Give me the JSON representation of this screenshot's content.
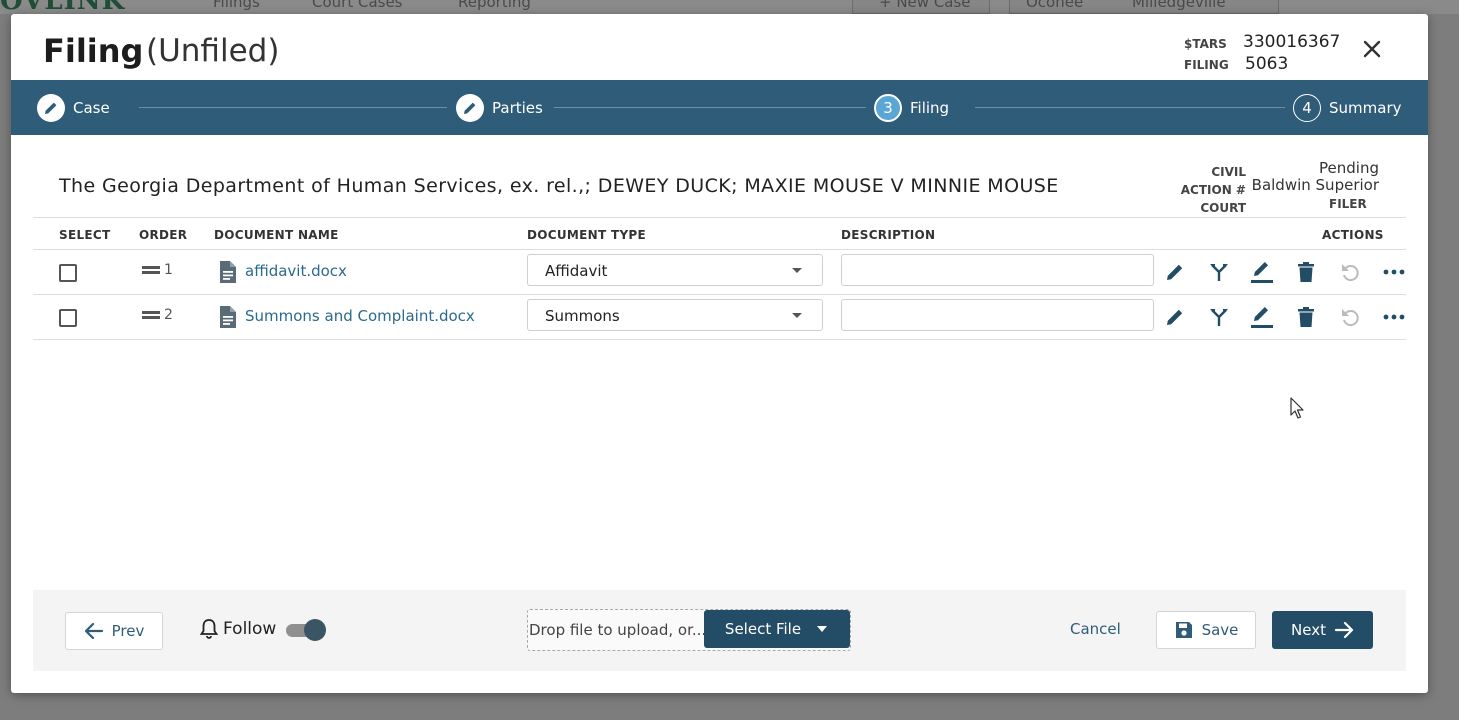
{
  "background": {
    "logo": "OVLINK",
    "nav": [
      "Filings",
      "Court Cases",
      "Reporting"
    ],
    "new_case": "+ New Case",
    "location": [
      "Oconee",
      "Milledgeville"
    ]
  },
  "modal": {
    "title": "Filing",
    "status": "(Unfiled)",
    "meta": {
      "stars_label": "$TARS",
      "stars_value": "330016367",
      "filing_label": "FILING",
      "filing_value": "5063"
    },
    "close_icon": "close-icon"
  },
  "stepper": {
    "steps": [
      {
        "label": "Case",
        "marker": "pencil-icon"
      },
      {
        "label": "Parties",
        "marker": "pencil-icon"
      },
      {
        "label": "Filing",
        "marker": "3"
      },
      {
        "label": "Summary",
        "marker": "4"
      }
    ],
    "active_index": 2
  },
  "case": {
    "title": "The Georgia Department of Human Services, ex. rel.,; DEWEY DUCK; MAXIE MOUSE V MINNIE MOUSE",
    "civil_action_label": "CIVIL ACTION #",
    "civil_action_value": "Pending",
    "court_label": "COURT",
    "court_value": "Baldwin Superior",
    "filer_label": "FILER"
  },
  "table": {
    "headers": [
      "SELECT",
      "ORDER",
      "DOCUMENT NAME",
      "DOCUMENT TYPE",
      "DESCRIPTION",
      "ACTIONS"
    ],
    "rows": [
      {
        "order": "1",
        "name": "affidavit.docx",
        "type": "Affidavit",
        "description": ""
      },
      {
        "order": "2",
        "name": "Summons and Complaint.docx",
        "type": "Summons",
        "description": ""
      }
    ],
    "action_icons": [
      "pencil-icon",
      "split-icon",
      "sign-icon",
      "trash-icon",
      "undo-icon",
      "more-icon"
    ]
  },
  "footer": {
    "prev_label": "Prev",
    "follow_label": "Follow",
    "follow_on": true,
    "drop_text": "Drop file to upload, or...",
    "select_file_label": "Select File",
    "cancel_label": "Cancel",
    "save_label": "Save",
    "next_label": "Next"
  },
  "colors": {
    "stepper_bg": "#2f5c78",
    "primary": "#234d66",
    "link": "#2a6a8e",
    "active_step": "#5aa7d6"
  }
}
